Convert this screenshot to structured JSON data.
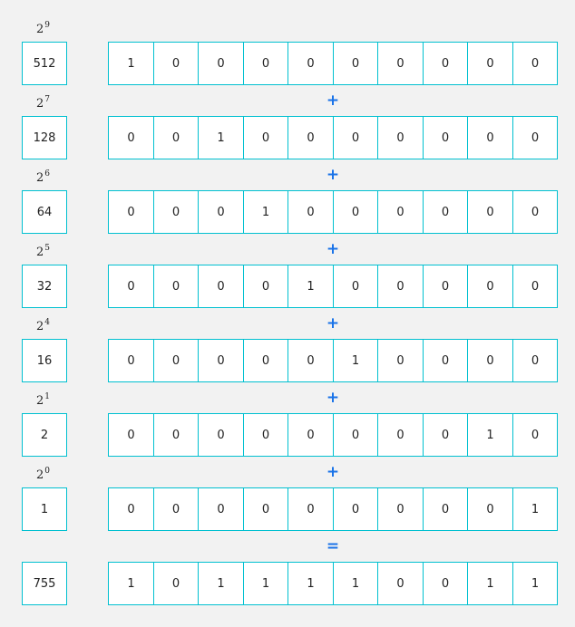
{
  "rows": [
    {
      "base": "2",
      "exp": "9",
      "value": "512",
      "bits": [
        "1",
        "0",
        "0",
        "0",
        "0",
        "0",
        "0",
        "0",
        "0",
        "0"
      ]
    },
    {
      "base": "2",
      "exp": "7",
      "value": "128",
      "bits": [
        "0",
        "0",
        "1",
        "0",
        "0",
        "0",
        "0",
        "0",
        "0",
        "0"
      ]
    },
    {
      "base": "2",
      "exp": "6",
      "value": "64",
      "bits": [
        "0",
        "0",
        "0",
        "1",
        "0",
        "0",
        "0",
        "0",
        "0",
        "0"
      ]
    },
    {
      "base": "2",
      "exp": "5",
      "value": "32",
      "bits": [
        "0",
        "0",
        "0",
        "0",
        "1",
        "0",
        "0",
        "0",
        "0",
        "0"
      ]
    },
    {
      "base": "2",
      "exp": "4",
      "value": "16",
      "bits": [
        "0",
        "0",
        "0",
        "0",
        "0",
        "1",
        "0",
        "0",
        "0",
        "0"
      ]
    },
    {
      "base": "2",
      "exp": "1",
      "value": "2",
      "bits": [
        "0",
        "0",
        "0",
        "0",
        "0",
        "0",
        "0",
        "0",
        "1",
        "0"
      ]
    },
    {
      "base": "2",
      "exp": "0",
      "value": "1",
      "bits": [
        "0",
        "0",
        "0",
        "0",
        "0",
        "0",
        "0",
        "0",
        "0",
        "1"
      ]
    }
  ],
  "plus_symbol": "+",
  "equals_symbol": "=",
  "result": {
    "value": "755",
    "bits": [
      "1",
      "0",
      "1",
      "1",
      "1",
      "1",
      "0",
      "0",
      "1",
      "1"
    ]
  },
  "colors": {
    "cell_border": "#00c0d0",
    "operator": "#1a73e8",
    "background": "#f2f2f2"
  }
}
